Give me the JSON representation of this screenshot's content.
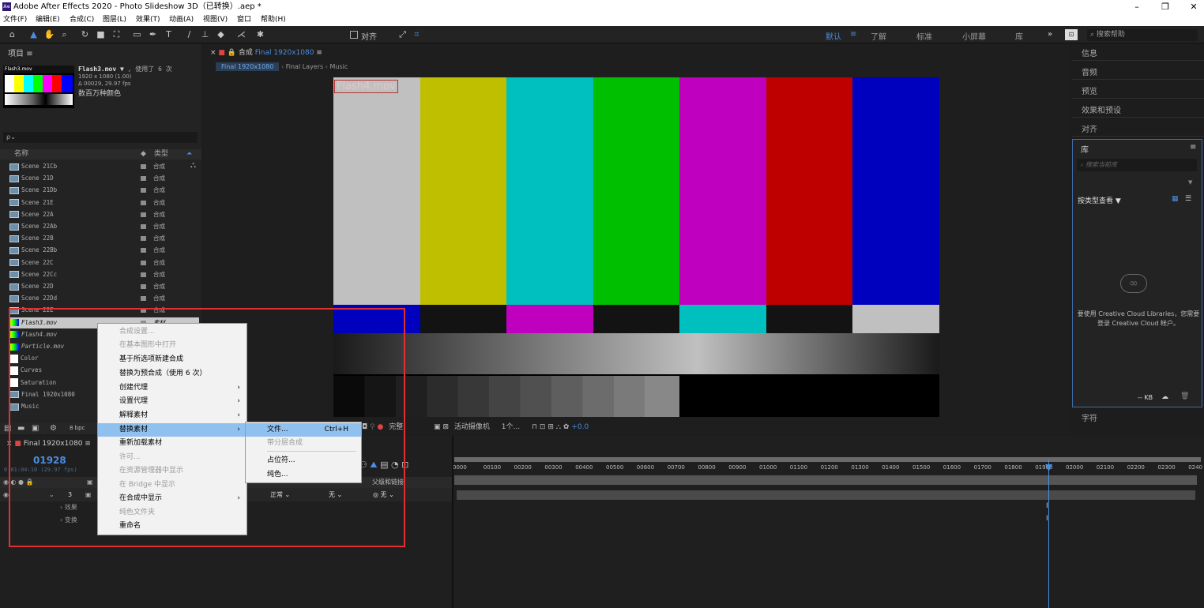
{
  "window": {
    "title": "Adobe After Effects 2020 - Photo Slideshow 3D（已转换）.aep *",
    "app_icon": "Ae",
    "minimize": "–",
    "restore": "❐",
    "close": "✕"
  },
  "menu": [
    "文件(F)",
    "编辑(E)",
    "合成(C)",
    "图层(L)",
    "效果(T)",
    "动画(A)",
    "视图(V)",
    "窗口",
    "帮助(H)"
  ],
  "toolbar": {
    "align_label": "对齐",
    "workspaces": [
      "默认",
      "了解",
      "标准",
      "小屏幕",
      "库"
    ],
    "active_workspace": "默认",
    "overflow": "»",
    "search_placeholder": "搜索帮助"
  },
  "project": {
    "title": "项目",
    "menu_icon": "≡",
    "footage_name": "Flash3.mov",
    "thumb_label": "Flash3.mov",
    "usage": ", 使用了 6 次",
    "dims": "1920 x 1080 (1.00)",
    "duration": "Δ 00029, 29.97 fps",
    "colors": "数百万种颜色",
    "search_icon": "ρ⌄",
    "col_name": "名称",
    "col_type": "类型",
    "bpc": "8 bpc",
    "items": [
      {
        "name": "Scene 21Cb",
        "type": "合成",
        "icon": "comp"
      },
      {
        "name": "Scene 21D",
        "type": "合成",
        "icon": "comp"
      },
      {
        "name": "Scene 21Db",
        "type": "合成",
        "icon": "comp"
      },
      {
        "name": "Scene 21E",
        "type": "合成",
        "icon": "comp"
      },
      {
        "name": "Scene 22A",
        "type": "合成",
        "icon": "comp"
      },
      {
        "name": "Scene 22Ab",
        "type": "合成",
        "icon": "comp"
      },
      {
        "name": "Scene 22B",
        "type": "合成",
        "icon": "comp"
      },
      {
        "name": "Scene 22Bb",
        "type": "合成",
        "icon": "comp"
      },
      {
        "name": "Scene 22C",
        "type": "合成",
        "icon": "comp"
      },
      {
        "name": "Scene 22Cc",
        "type": "合成",
        "icon": "comp"
      },
      {
        "name": "Scene 22D",
        "type": "合成",
        "icon": "comp"
      },
      {
        "name": "Scene 22Dd",
        "type": "合成",
        "icon": "comp"
      },
      {
        "name": "Scene 22E",
        "type": "合成",
        "icon": "comp"
      },
      {
        "name": "Flash3.mov",
        "type": "素材",
        "icon": "footage"
      },
      {
        "name": "Flash4.mov",
        "type": "",
        "icon": "footage"
      },
      {
        "name": "Particle.mov",
        "type": "",
        "icon": "footage"
      },
      {
        "name": "Color",
        "type": "",
        "icon": "solid"
      },
      {
        "name": "Curves",
        "type": "",
        "icon": "solid"
      },
      {
        "name": "Saturation",
        "type": "",
        "icon": "solid"
      },
      {
        "name": "Final 1920x1080",
        "type": "",
        "icon": "comp"
      },
      {
        "name": "Music",
        "type": "",
        "icon": "comp"
      }
    ]
  },
  "comp": {
    "tab_label": "合成",
    "tab_name": "Final 1920x1080",
    "breadcrumbs": [
      "Final 1920x1080",
      "Final Layers",
      "Music"
    ],
    "layer_label": "Flash4.mov",
    "quality": "完整",
    "camera": "活动摄像机",
    "views": "1个...",
    "exposure": "+0.0"
  },
  "right_panels": [
    "信息",
    "音频",
    "预览",
    "效果和预设",
    "对齐"
  ],
  "library": {
    "title": "库",
    "search_placeholder": "搜索当前库",
    "view_by": "按类型查看",
    "message": "要使用 Creative Cloud Libraries，您需要登录 Creative Cloud 帐户。",
    "size": "-- KB",
    "more_panels": [
      "字符"
    ]
  },
  "timeline": {
    "tab": "Final 1920x1080",
    "timecode": "01928",
    "fps": "0:01:04:10 (29.97 fps)",
    "col_parent": "父级和链接",
    "layer_num": "3",
    "mode": "正常",
    "trkmat": "无",
    "parent": "无",
    "sub_rows": [
      "效果",
      "变换"
    ],
    "ticks": [
      "0000",
      "00100",
      "00200",
      "00300",
      "00400",
      "00500",
      "00600",
      "00700",
      "00800",
      "00900",
      "01000",
      "01100",
      "01200",
      "01300",
      "01400",
      "01500",
      "01600",
      "01700",
      "01800",
      "01900",
      "02000",
      "02100",
      "02200",
      "02300",
      "0240"
    ]
  },
  "context_menu": [
    {
      "label": "合成设置...",
      "disabled": true
    },
    {
      "label": "在基本图形中打开",
      "disabled": true
    },
    {
      "label": "基于所选项新建合成",
      "disabled": false
    },
    {
      "label": "替换为预合成（使用 6 次）",
      "disabled": false
    },
    {
      "label": "创建代理",
      "disabled": false,
      "arrow": true
    },
    {
      "label": "设置代理",
      "disabled": false,
      "arrow": true
    },
    {
      "label": "解释素材",
      "disabled": false,
      "arrow": true
    },
    {
      "label": "替换素材",
      "disabled": false,
      "arrow": true,
      "highlighted": true
    },
    {
      "label": "重新加载素材",
      "disabled": false
    },
    {
      "label": "许可...",
      "disabled": true
    },
    {
      "label": "在资源管理器中显示",
      "disabled": true
    },
    {
      "label": "在 Bridge 中显示",
      "disabled": true
    },
    {
      "label": "在合成中显示",
      "disabled": false,
      "arrow": true
    },
    {
      "label": "纯色文件夹",
      "disabled": true
    },
    {
      "label": "重命名",
      "disabled": false
    }
  ],
  "submenu": [
    {
      "label": "文件...",
      "shortcut": "Ctrl+H",
      "highlighted": true
    },
    {
      "label": "带分层合成",
      "disabled": true
    },
    {
      "label": "占位符...",
      "disabled": false
    },
    {
      "label": "纯色...",
      "disabled": false
    }
  ],
  "colors": {
    "highlight_box": "#e03030",
    "accent": "#4a8de0",
    "bars_top": [
      "#c0c0c0",
      "#bfbf00",
      "#00bfbf",
      "#00bf00",
      "#bf00bf",
      "#bf0000",
      "#0000bf"
    ]
  }
}
